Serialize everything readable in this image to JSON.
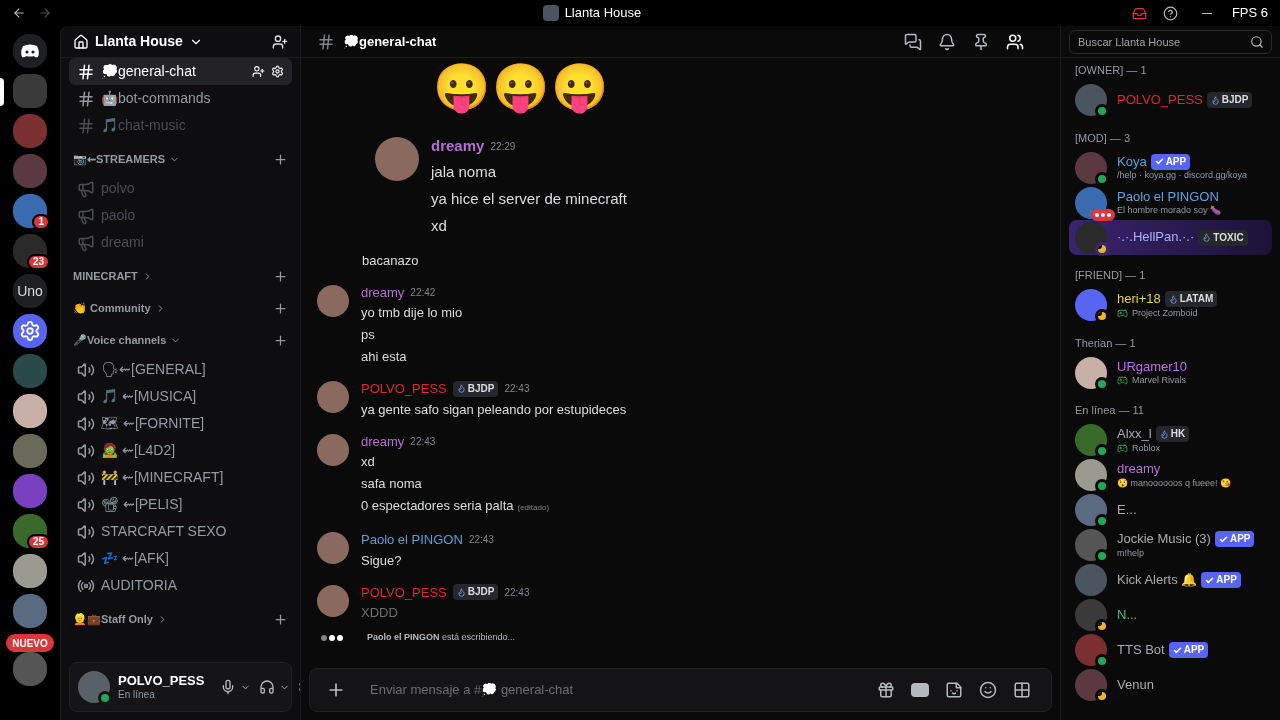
{
  "titlebar": {
    "title": "Llanta House",
    "fps": "FPS 6"
  },
  "rail": {
    "servers": [
      {
        "kind": "home",
        "selected": false
      },
      {
        "kind": "photo",
        "selected": true
      },
      {
        "kind": "photo",
        "selected": false
      },
      {
        "kind": "photo",
        "selected": false
      },
      {
        "kind": "photo",
        "selected": false,
        "badge": "1"
      },
      {
        "kind": "photo",
        "selected": false,
        "badge": "23"
      },
      {
        "kind": "text",
        "label": "Uno",
        "selected": false
      },
      {
        "kind": "bot",
        "selected": false
      },
      {
        "kind": "photo",
        "selected": false
      },
      {
        "kind": "photo",
        "selected": false
      },
      {
        "kind": "photo",
        "selected": false
      },
      {
        "kind": "photo",
        "selected": false
      },
      {
        "kind": "photo",
        "selected": false,
        "badge": "25"
      },
      {
        "kind": "photo",
        "selected": false
      },
      {
        "kind": "photo",
        "selected": false
      },
      {
        "kind": "photo",
        "selected": false,
        "pill": "NUEVO"
      }
    ]
  },
  "sidebar": {
    "server_name": "Llanta House",
    "sections": [
      {
        "kind": "plain",
        "items": [
          {
            "kind": "text",
            "name": "💭general-chat",
            "selected": true,
            "muted": false
          },
          {
            "kind": "text",
            "name": "🤖bot-commands",
            "selected": false,
            "muted": false
          },
          {
            "kind": "text",
            "name": "🎵chat-music",
            "selected": false,
            "muted": true
          }
        ]
      },
      {
        "kind": "category",
        "name": "📷⇜STREAMERS",
        "expanded": true,
        "items": [
          {
            "kind": "announcement",
            "name": "polvo",
            "selected": false,
            "muted": true
          },
          {
            "kind": "announcement",
            "name": "paolo",
            "selected": false,
            "muted": true
          },
          {
            "kind": "announcement",
            "name": "dreami",
            "selected": false,
            "muted": true
          }
        ]
      },
      {
        "kind": "category",
        "name": "MINECRAFT",
        "expanded": false
      },
      {
        "kind": "category",
        "name": "👏 Community",
        "expanded": false
      },
      {
        "kind": "category",
        "name": "🎤Voice channels",
        "expanded": true,
        "items": [
          {
            "kind": "voice",
            "name": "🗣⇜[GENERAL]",
            "selected": false,
            "muted": false
          },
          {
            "kind": "voice",
            "name": "🎵 ⇜[MUSICA]",
            "selected": false,
            "muted": false
          },
          {
            "kind": "voice",
            "name": "🗺 ⇜[FORNITE]",
            "selected": false,
            "muted": false
          },
          {
            "kind": "voice",
            "name": "🧟 ⇜[L4D2]",
            "selected": false,
            "muted": false
          },
          {
            "kind": "voice",
            "name": "🚧 ⇜[MINECRAFT]",
            "selected": false,
            "muted": false
          },
          {
            "kind": "voice",
            "name": "📽 ⇜[PELIS]",
            "selected": false,
            "muted": false
          },
          {
            "kind": "voice",
            "name": "STARCRAFT SEXO",
            "selected": false,
            "muted": false
          },
          {
            "kind": "voice",
            "name": "💤 ⇜[AFK]",
            "selected": false,
            "muted": false
          },
          {
            "kind": "stage",
            "name": "AUDITORIA",
            "selected": false,
            "muted": false
          }
        ]
      },
      {
        "kind": "category",
        "name": "👱💼Staff Only",
        "expanded": false
      }
    ],
    "user": {
      "name": "POLVO_PESS",
      "status_text": "En línea",
      "status": {
        "kind": "online"
      }
    }
  },
  "chat": {
    "channel": "💭general-chat",
    "search_placeholder": "Buscar Llanta House",
    "messages": [
      {
        "kind": "emoji_row",
        "emojis": [
          "😛",
          "😛",
          "😛"
        ]
      },
      {
        "kind": "group",
        "author": "dreamy",
        "color": "#b46fd6",
        "time": "22:29",
        "large": true,
        "lines": [
          {
            "text": "jala noma"
          },
          {
            "text": "ya hice el server de minecraft"
          },
          {
            "text": "xd"
          }
        ]
      },
      {
        "kind": "plain",
        "lines": [
          {
            "text": "bacanazo"
          }
        ]
      },
      {
        "kind": "group",
        "author": "dreamy",
        "color": "#b46fd6",
        "time": "22:42",
        "lines": [
          {
            "text": "yo tmb dije lo mio"
          },
          {
            "text": "ps"
          },
          {
            "text": "ahi esta"
          }
        ]
      },
      {
        "kind": "group",
        "author": "POLVO_PESS",
        "color": "#d62b2b",
        "tag": "BJDP",
        "time": "22:43",
        "lines": [
          {
            "text": "ya gente safo sigan peleando por estupideces"
          }
        ]
      },
      {
        "kind": "group",
        "author": "dreamy",
        "color": "#b46fd6",
        "time": "22:43",
        "lines": [
          {
            "text": "xd"
          },
          {
            "text": "safa noma"
          },
          {
            "text": "0 espectadores seria palta",
            "edited": "(editado)"
          }
        ]
      },
      {
        "kind": "group",
        "author": "Paolo el PINGON",
        "color": "#5b9fd6",
        "time": "22:43",
        "lines": [
          {
            "text": "Sigue?"
          }
        ]
      },
      {
        "kind": "group",
        "author": "POLVO_PESS",
        "color": "#d62b2b",
        "tag": "BJDP",
        "time": "22:43",
        "lines": [
          {
            "text": "XDDD",
            "pending": true
          }
        ]
      }
    ],
    "typing": "**Paolo el PINGON** está escribiendo...",
    "input_placeholder": "Enviar mensaje a #💭 general-chat"
  },
  "members": {
    "groups": [
      {
        "title": "[OWNER] — 1",
        "members": [
          {
            "name": "POLVO_PESS",
            "color": "#e0262b",
            "status": {
              "kind": "online"
            },
            "tag": "BJDP"
          }
        ]
      },
      {
        "title": "[MOD] — 3",
        "members": [
          {
            "name": "Koya",
            "color": "#5ba4e0",
            "status": {
              "kind": "online"
            },
            "app": "APP",
            "activity": {
              "kind": "custom",
              "text": "/help · koya.gg · discord.gg/koya"
            }
          },
          {
            "name": "Paolo el PINGON",
            "color": "#5ba4e0",
            "status": {
              "kind": "typing"
            },
            "activity": {
              "kind": "custom",
              "text": "El hombre morado soy 🍆"
            }
          },
          {
            "name": "·.·.HellPan.·.·",
            "color": "#a8b4ff",
            "status": {
              "kind": "idle"
            },
            "tag": "TOXIC",
            "nameplate": true
          }
        ]
      },
      {
        "title": "[FRIEND] — 1",
        "members": [
          {
            "name": "heri+18",
            "color": "#e8d04a",
            "status": {
              "kind": "idle"
            },
            "tag": "LATAM",
            "activity": {
              "kind": "game",
              "text": "Project Zomboid"
            }
          }
        ]
      },
      {
        "title": "Therian — 1",
        "members": [
          {
            "name": "URgamer10",
            "color": "#c46be6",
            "status": {
              "kind": "online"
            },
            "activity": {
              "kind": "game",
              "text": "Marvel Rivals"
            }
          }
        ]
      },
      {
        "title": "En línea — 11",
        "members": [
          {
            "name": "Alxx_l",
            "color": "#a8abb2",
            "status": {
              "kind": "online"
            },
            "tag": "HK",
            "activity": {
              "kind": "game",
              "text": "Roblox"
            }
          },
          {
            "name": "dreamy",
            "color": "#b46fd6",
            "status": {
              "kind": "online"
            },
            "activity": {
              "kind": "custom",
              "text": "😯 manoooooos q fueee! 😘"
            }
          },
          {
            "name": "E...",
            "color": "#a8abb2",
            "status": {
              "kind": "online"
            }
          },
          {
            "name": "Jockie Music (3)",
            "color": "#a8abb2",
            "status": {
              "kind": "online"
            },
            "app": "APP",
            "activity": {
              "kind": "custom",
              "text": "m!help"
            }
          },
          {
            "name": "Kick Alerts 🔔",
            "color": "#a8abb2",
            "app": "APP"
          },
          {
            "name": "N...",
            "color": "#3fbf6a",
            "status": {
              "kind": "idle"
            }
          },
          {
            "name": "TTS Bot",
            "color": "#a8abb2",
            "status": {
              "kind": "online"
            },
            "app": "APP"
          },
          {
            "name": "Venun",
            "color": "#a8abb2",
            "status": {
              "kind": "idle"
            }
          }
        ]
      }
    ]
  }
}
